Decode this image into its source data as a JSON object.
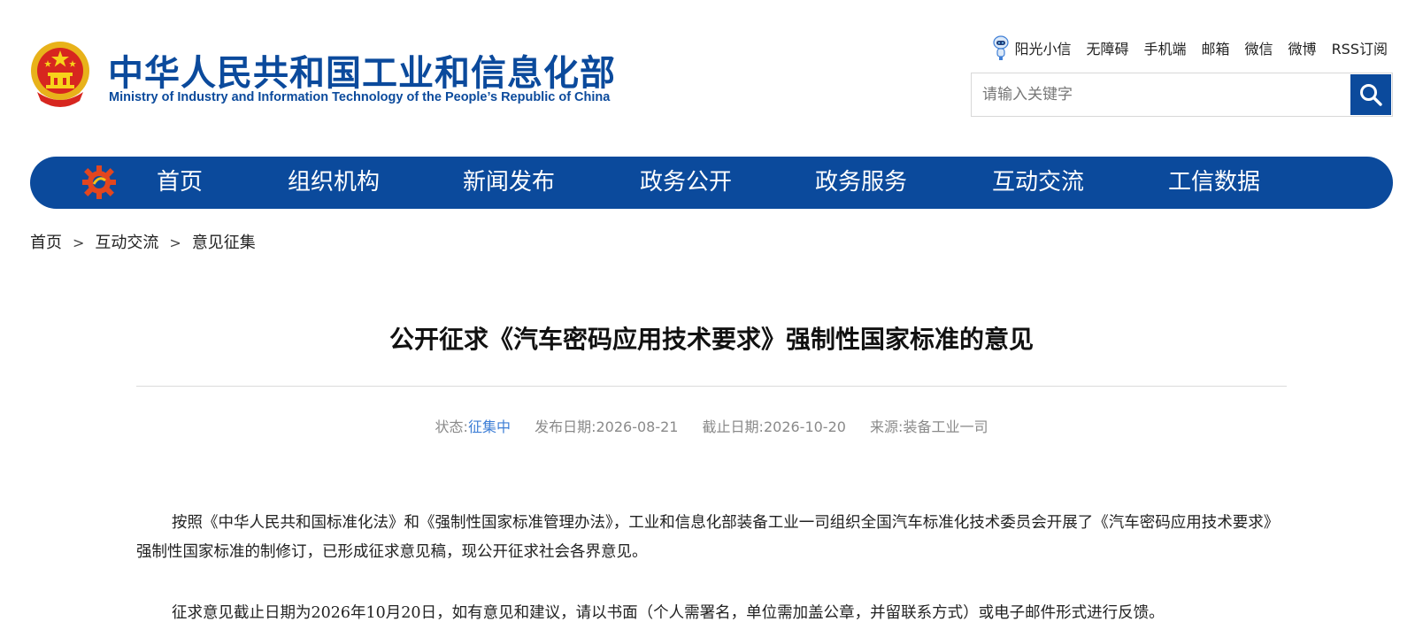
{
  "header": {
    "title_cn": "中华人民共和国工业和信息化部",
    "title_en": "Ministry of Industry and Information Technology of the People’s Republic of China",
    "emblem_icon": "national-emblem-icon",
    "top_links": [
      "阳光小信",
      "无障碍",
      "手机端",
      "邮箱",
      "微信",
      "微博",
      "RSS订阅"
    ],
    "search": {
      "placeholder": "请输入关键字",
      "icon": "search-icon"
    }
  },
  "nav": {
    "logo_icon": "gear-logo-icon",
    "items": [
      "首页",
      "组织机构",
      "新闻发布",
      "政务公开",
      "政务服务",
      "互动交流",
      "工信数据"
    ]
  },
  "breadcrumb": {
    "items": [
      "首页",
      "互动交流",
      "意见征集"
    ],
    "separator": ">"
  },
  "article": {
    "title": "公开征求《汽车密码应用技术要求》强制性国家标准的意见",
    "meta": {
      "status_label": "状态:",
      "status_value": "征集中",
      "publish_label": "发布日期:",
      "publish_date": "2026-08-21",
      "deadline_label": "截止日期:",
      "deadline_date": "2026-10-20",
      "source_label": "来源:",
      "source_value": "装备工业一司"
    },
    "paragraphs": [
      "按照《中华人民共和国标准化法》和《强制性国家标准管理办法》，工业和信息化部装备工业一司组织全国汽车标准化技术委员会开展了《汽车密码应用技术要求》强制性国家标准的制修订，已形成征求意见稿，现公开征求社会各界意见。",
      "征求意见截止日期为2026年10月20日，如有意见和建议，请以书面（个人需署名，单位需加盖公章，并留联系方式）或电子邮件形式进行反馈。"
    ]
  },
  "colors": {
    "brand_blue": "#0b4a9c",
    "status_blue": "#3f7fd6",
    "meta_gray": "#8a8a8a"
  }
}
